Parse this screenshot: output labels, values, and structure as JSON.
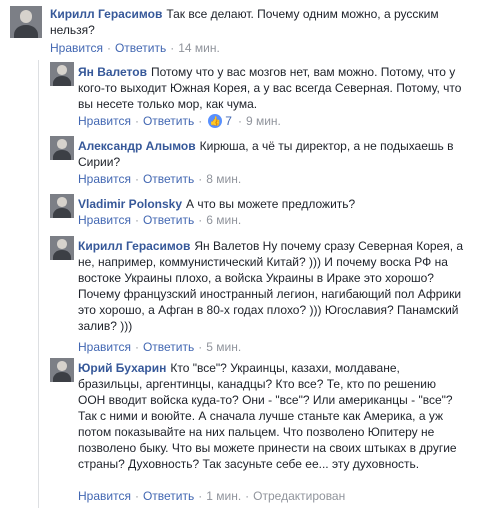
{
  "actions": {
    "like": "Нравится",
    "reply": "Ответить",
    "separator": "·"
  },
  "comments": [
    {
      "author": "Кирилл Герасимов",
      "text": "Так все делают. Почему одним можно, а русским нельзя?",
      "time": "14 мин."
    },
    {
      "author": "Ян Валетов",
      "text": "Потому что у вас мозгов нет, вам можно. Потому, что у кого-то выходит Южная Корея, а у вас всегда Северная. Потому, что вы несете только мор, как чума.",
      "reactions": "7",
      "time": "9 мин."
    },
    {
      "author": "Александр Алымов",
      "text": "Кирюша, а чё ты директор, а не подыхаешь в Сирии?",
      "time": "8 мин."
    },
    {
      "author": "Vladimir Polonsky",
      "text": "А что вы можете предложить?",
      "time": "6 мин."
    },
    {
      "author": "Кирилл Герасимов",
      "text": "Ян Валетов Ну почему сразу Северная Корея, а не, например, коммунистический Китай? ))) И почему воска РФ на востоке Украины плохо, а войска Украины в Ираке это хорошо? Почему французский иностранный легион, нагибающий пол Африки это хорошо, а Афган в 80-х годах плохо? ))) Югославия? Панамский залив? )))",
      "time": "5 мин."
    },
    {
      "author": "Юрий Бухарин",
      "text": "Кто \"все\"? Украинцы, казахи, молдаване, бразильцы, аргентинцы, канадцы? Кто все? Те, кто по решению ООН вводит войска куда-то? Они - \"все\"? Или американцы - \"все\"? Так с ними и воюйте. А сначала лучше станьте как Америка, а уж потом показывайте на них пальцем. Что позволено Юпитеру не позволено быку. Что вы можете принести на своих штыках в другие страны? Духовность? Так засуньте себе ее... эту духовность.",
      "time": "1 мин.",
      "edited": "Отредактирован"
    }
  ]
}
